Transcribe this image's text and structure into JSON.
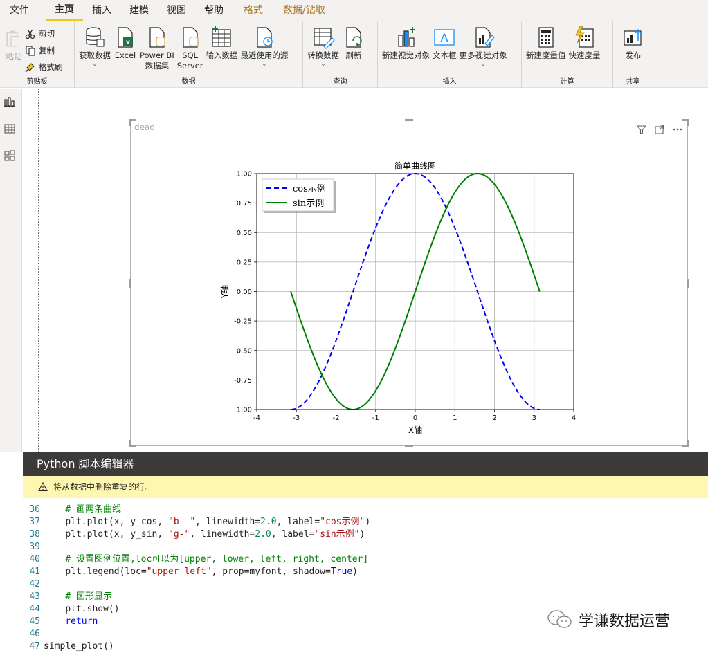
{
  "menu": {
    "items": [
      {
        "label": "文件"
      },
      {
        "label": "主页"
      },
      {
        "label": "插入"
      },
      {
        "label": "建模"
      },
      {
        "label": "视图"
      },
      {
        "label": "帮助"
      },
      {
        "label": "格式"
      },
      {
        "label": "数据/钻取"
      }
    ]
  },
  "ribbon": {
    "clipboard": {
      "label": "剪贴板",
      "paste": "粘贴",
      "cut": "剪切",
      "copy": "复制",
      "format_painter": "格式刷"
    },
    "data": {
      "label": "数据",
      "get_data": "获取数据",
      "excel": "Excel",
      "powerbi_1": "Power BI",
      "powerbi_2": "数据集",
      "sql_1": "SQL",
      "sql_2": "Server",
      "enter_data": "输入数据",
      "recent": "最近使用的源"
    },
    "query": {
      "label": "查询",
      "transform": "转换数据",
      "refresh": "刷新"
    },
    "insert": {
      "label": "插入",
      "new_visual": "新建视觉对象",
      "textbox": "文本框",
      "more_visuals": "更多视觉对象"
    },
    "calc": {
      "label": "计算",
      "new_measure": "新建度量值",
      "quick_measure": "快速度量"
    },
    "share": {
      "label": "共享",
      "publish": "发布"
    }
  },
  "visual": {
    "title": "dead"
  },
  "chart_data": {
    "type": "line",
    "title": "简单曲线图",
    "xlabel": "X轴",
    "ylabel": "Y轴",
    "xlim": [
      -4,
      4
    ],
    "ylim": [
      -1.0,
      1.0
    ],
    "xticks": [
      "-4",
      "-3",
      "-2",
      "-1",
      "0",
      "1",
      "2",
      "3",
      "4"
    ],
    "yticks": [
      "1.00",
      "0.75",
      "0.50",
      "0.25",
      "0.00",
      "-0.25",
      "-0.50",
      "-0.75",
      "-1.00"
    ],
    "grid": true,
    "legend_position": "upper left",
    "series": [
      {
        "name": "cos示例",
        "color": "#0000ff",
        "style": "dashed",
        "function": "cos",
        "x_range": [
          -3.14159,
          3.14159
        ]
      },
      {
        "name": "sin示例",
        "color": "#008000",
        "style": "solid",
        "function": "sin",
        "x_range": [
          -3.14159,
          3.14159
        ]
      }
    ]
  },
  "editor": {
    "title": "Python 脚本编辑器",
    "warning": "将从数据中删除重复的行。",
    "lines": [
      {
        "n": "36",
        "indent": "    ",
        "parts": [
          {
            "t": "# 画两条曲线",
            "c": "comment"
          }
        ]
      },
      {
        "n": "37",
        "indent": "    ",
        "parts": [
          {
            "t": "plt.plot(x, y_cos, ",
            "c": ""
          },
          {
            "t": "\"b--\"",
            "c": "str"
          },
          {
            "t": ", linewidth=",
            "c": ""
          },
          {
            "t": "2.0",
            "c": "num"
          },
          {
            "t": ", label=",
            "c": ""
          },
          {
            "t": "\"cos示例\"",
            "c": "str"
          },
          {
            "t": ")",
            "c": ""
          }
        ]
      },
      {
        "n": "38",
        "indent": "    ",
        "parts": [
          {
            "t": "plt.plot(x, y_sin, ",
            "c": ""
          },
          {
            "t": "\"g-\"",
            "c": "str"
          },
          {
            "t": ", linewidth=",
            "c": ""
          },
          {
            "t": "2.0",
            "c": "num"
          },
          {
            "t": ", label=",
            "c": ""
          },
          {
            "t": "\"sin示例\"",
            "c": "str"
          },
          {
            "t": ")",
            "c": ""
          }
        ]
      },
      {
        "n": "39",
        "indent": "",
        "parts": []
      },
      {
        "n": "40",
        "indent": "    ",
        "parts": [
          {
            "t": "# 设置图例位置,loc可以为[upper, lower, left, right, center]",
            "c": "comment"
          }
        ]
      },
      {
        "n": "41",
        "indent": "    ",
        "parts": [
          {
            "t": "plt.legend(loc=",
            "c": ""
          },
          {
            "t": "\"upper left\"",
            "c": "str"
          },
          {
            "t": ", prop=myfont, shadow=",
            "c": ""
          },
          {
            "t": "True",
            "c": "kw"
          },
          {
            "t": ")",
            "c": ""
          }
        ]
      },
      {
        "n": "42",
        "indent": "",
        "parts": []
      },
      {
        "n": "43",
        "indent": "    ",
        "parts": [
          {
            "t": "# 图形显示",
            "c": "comment"
          }
        ]
      },
      {
        "n": "44",
        "indent": "    ",
        "parts": [
          {
            "t": "plt.show()",
            "c": ""
          }
        ]
      },
      {
        "n": "45",
        "indent": "    ",
        "parts": [
          {
            "t": "return",
            "c": "kw"
          }
        ]
      },
      {
        "n": "46",
        "indent": "",
        "parts": []
      },
      {
        "n": "47",
        "indent": "",
        "parts": [
          {
            "t": "simple_plot()",
            "c": ""
          }
        ]
      }
    ]
  },
  "watermark": {
    "text": "学谦数据运营"
  }
}
